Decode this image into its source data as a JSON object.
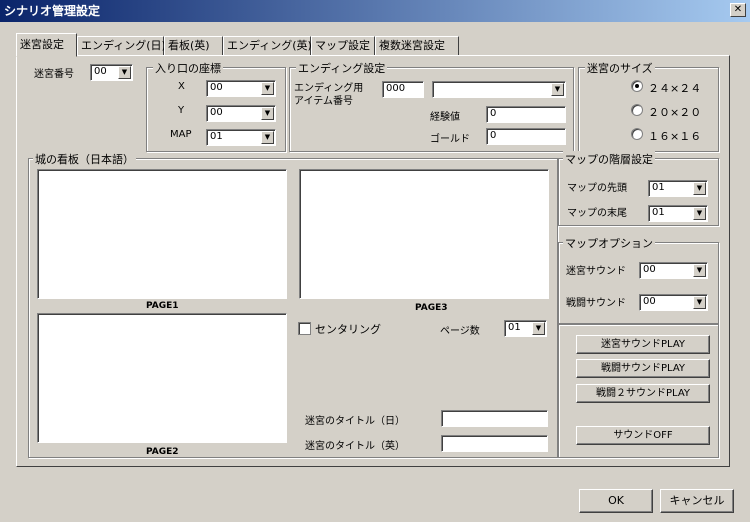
{
  "window": {
    "title": "シナリオ管理設定",
    "close": "✕"
  },
  "tabs": [
    "迷宮設定",
    "エンディング(日)",
    "看板(英)",
    "エンディング(英)",
    "マップ設定",
    "複数迷宮設定"
  ],
  "maze_number": {
    "label": "迷宮番号",
    "value": "00"
  },
  "entrance": {
    "title": "入り口の座標",
    "x_label": "X",
    "x_value": "00",
    "y_label": "Y",
    "y_value": "00",
    "map_label": "MAP",
    "map_value": "01"
  },
  "ending": {
    "title": "エンディング設定",
    "item_label_1": "エンディング用",
    "item_label_2": "アイテム番号",
    "item_value": "000",
    "item_combo": "",
    "exp_label": "経験値",
    "exp_value": "0",
    "gold_label": "ゴールド",
    "gold_value": "0"
  },
  "size": {
    "title": "迷宮のサイズ",
    "options": [
      "２４×２４",
      "２０×２０",
      "１６×１６"
    ],
    "selected": 0
  },
  "signboard": {
    "title": "城の看板（日本語）",
    "page1": "PAGE1",
    "page2": "PAGE2",
    "page3": "PAGE3",
    "centering": "センタリング",
    "page_count_label": "ページ数",
    "page_count_value": "01"
  },
  "titles": {
    "jp_label": "迷宮のタイトル（日）",
    "jp_value": "",
    "en_label": "迷宮のタイトル（英）",
    "en_value": ""
  },
  "hierarchy": {
    "title": "マップの階層設定",
    "start_label": "マップの先頭",
    "start_value": "01",
    "end_label": "マップの末尾",
    "end_value": "01"
  },
  "map_options": {
    "title": "マップオプション",
    "maze_sound_label": "迷宮サウンド",
    "maze_sound_value": "00",
    "battle_sound_label": "戦闘サウンド",
    "battle_sound_value": "00"
  },
  "sound_buttons": {
    "maze_play": "迷宮サウンドPLAY",
    "battle_play": "戦闘サウンドPLAY",
    "battle2_play": "戦闘２サウンドPLAY",
    "off": "サウンドOFF"
  },
  "dialog": {
    "ok": "OK",
    "cancel": "キャンセル"
  }
}
